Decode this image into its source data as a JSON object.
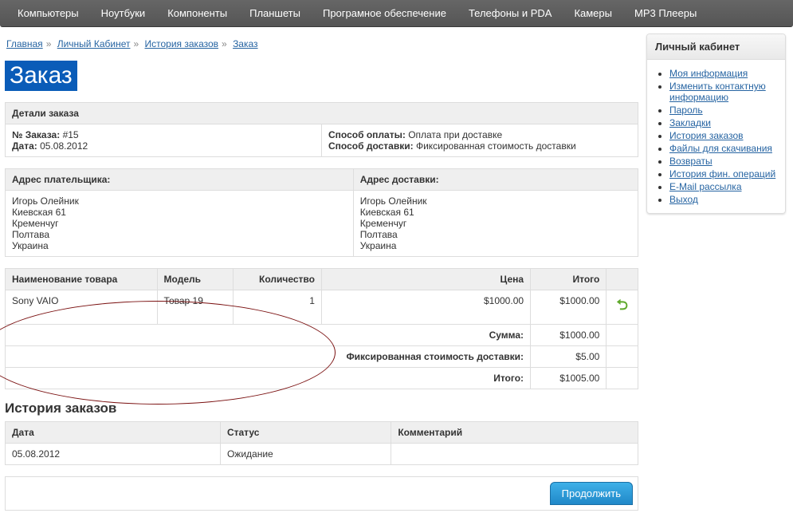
{
  "nav": {
    "items": [
      "Компьютеры",
      "Ноутбуки",
      "Компоненты",
      "Планшеты",
      "Програмное обеспечение",
      "Телефоны и PDA",
      "Камеры",
      "MP3 Плееры"
    ]
  },
  "breadcrumb": {
    "home": "Главная",
    "account": "Личный Кабинет",
    "history": "История заказов",
    "order": "Заказ"
  },
  "title": "Заказ",
  "details": {
    "header": "Детали заказа",
    "order_no_label": "№ Заказа:",
    "order_no": "#15",
    "date_label": "Дата:",
    "date": "05.08.2012",
    "pay_label": "Способ оплаты:",
    "pay": "Оплата при доставке",
    "ship_label": "Способ доставки:",
    "ship": "Фиксированная стоимость доставки"
  },
  "addr": {
    "payerHeader": "Адрес плательщика:",
    "shipHeader": "Адрес доставки:",
    "name": "Игорь Олейник",
    "street": "Киевская 61",
    "city": "Кременчуг",
    "region": "Полтава",
    "country": "Украина"
  },
  "items": {
    "cols": {
      "name": "Наименование товара",
      "model": "Модель",
      "qty": "Количество",
      "price": "Цена",
      "total": "Итого"
    },
    "rows": [
      {
        "name": "Sony VAIO",
        "model": "Товар 19",
        "qty": "1",
        "price": "$1000.00",
        "total": "$1000.00"
      }
    ],
    "summary": {
      "subtotal_label": "Сумма:",
      "subtotal": "$1000.00",
      "ship_label": "Фиксированная стоимость доставки:",
      "ship": "$5.00",
      "grand_label": "Итого:",
      "grand": "$1005.00"
    }
  },
  "history": {
    "header": "История заказов",
    "cols": {
      "date": "Дата",
      "status": "Статус",
      "comment": "Комментарий"
    },
    "rows": [
      {
        "date": "05.08.2012",
        "status": "Ожидание",
        "comment": ""
      }
    ]
  },
  "continue": "Продолжить",
  "side": {
    "header": "Личный кабинет",
    "links": [
      "Моя информация",
      "Изменить контактную информацию",
      "Пароль",
      "Закладки",
      "История заказов",
      "Файлы для скачивания",
      "Возвраты",
      "История фин. операций",
      "E-Mail рассылка",
      "Выход"
    ]
  }
}
